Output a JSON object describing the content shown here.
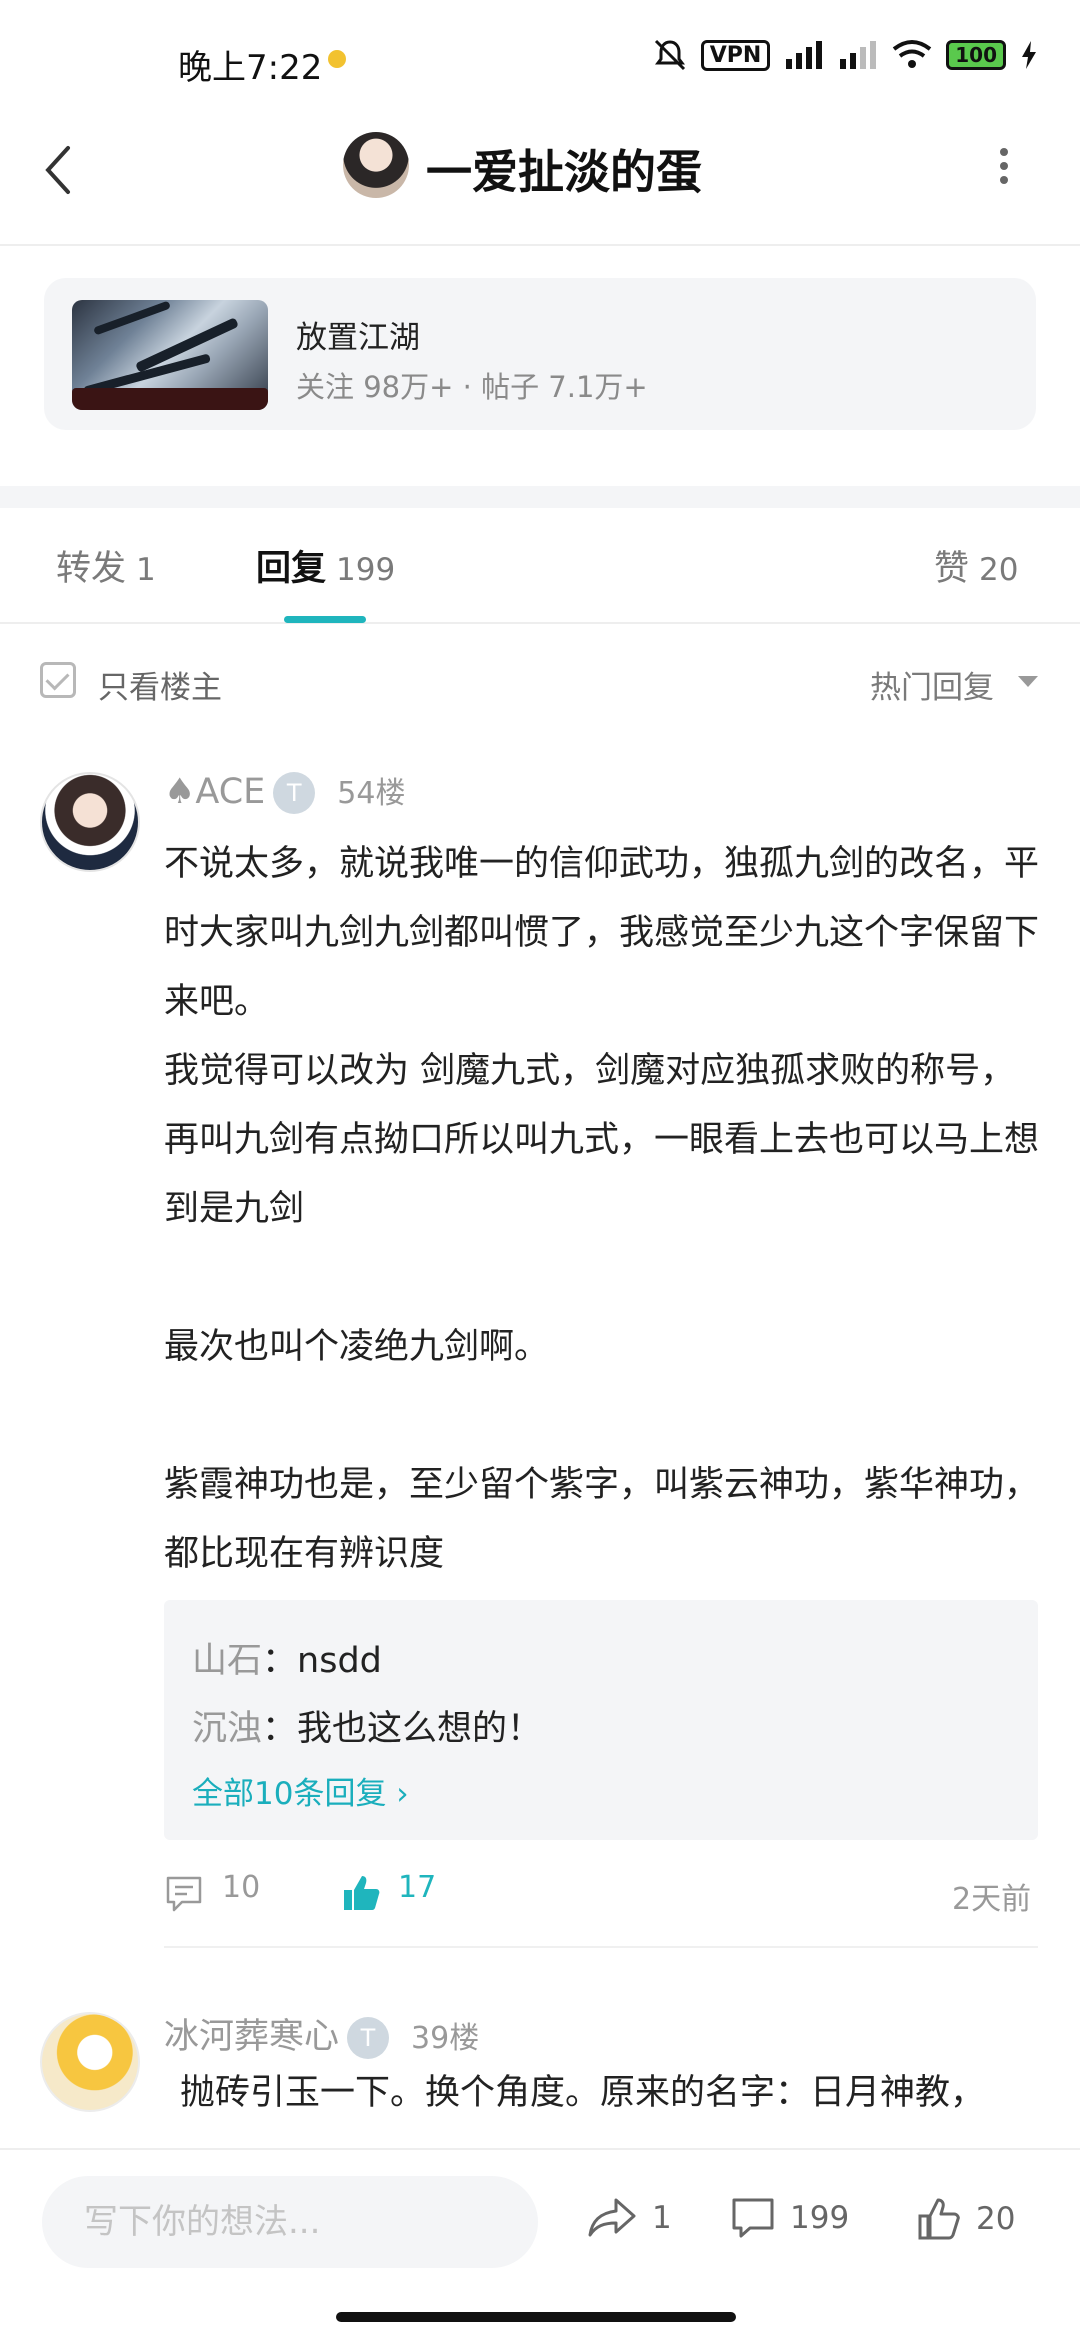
{
  "status_bar": {
    "time": "晚上7:22",
    "vpn": "VPN",
    "battery": "100",
    "icons": [
      "mute-icon",
      "vpn-icon",
      "signal-icon",
      "signal-icon",
      "wifi-icon",
      "battery-icon",
      "charging-icon"
    ]
  },
  "nav": {
    "title": "一爱扯淡的蛋"
  },
  "topic": {
    "name": "放置江湖",
    "stats": "关注 98万+  ·  帖子 7.1万+"
  },
  "tabs": {
    "forward_label": "转发",
    "forward_count": "1",
    "reply_label": "回复",
    "reply_count": "199",
    "like_label": "赞",
    "like_count": "20"
  },
  "filter": {
    "only_op": "只看楼主",
    "sort": "热门回复"
  },
  "posts": [
    {
      "user": "♠ACE",
      "badge": "T",
      "floor": "54楼",
      "text": "不说太多，就说我唯一的信仰武功，独孤九剑的改名，平时大家叫九剑九剑都叫惯了，我感觉至少九这个字保留下来吧。\n我觉得可以改为 剑魔九式，剑魔对应独孤求败的称号，再叫九剑有点拗口所以叫九式，一眼看上去也可以马上想到是九剑\n\n最次也叫个凌绝九剑啊。\n\n紫霞神功也是，至少留个紫字，叫紫云神功，紫华神功，都比现在有辨识度",
      "replies": [
        {
          "who": "山石",
          "text": "nsdd"
        },
        {
          "who": "沉浊",
          "text": "我也这么想的！"
        }
      ],
      "all_replies": "全部10条回复 ›",
      "comment_count": "10",
      "like_count": "17",
      "time": "2天前"
    },
    {
      "user": "冰河葬寒心",
      "badge": "T",
      "floor": "39楼",
      "text": "抛砖引玉一下。换个角度。原来的名字：日月神教，"
    }
  ],
  "bottom": {
    "placeholder": "写下你的想法...",
    "forward_count": "1",
    "comment_count": "199",
    "like_count": "20"
  },
  "colors": {
    "accent": "#1fb5bd",
    "text": "#222222",
    "muted": "#999999",
    "card_bg": "#f4f5f7"
  }
}
